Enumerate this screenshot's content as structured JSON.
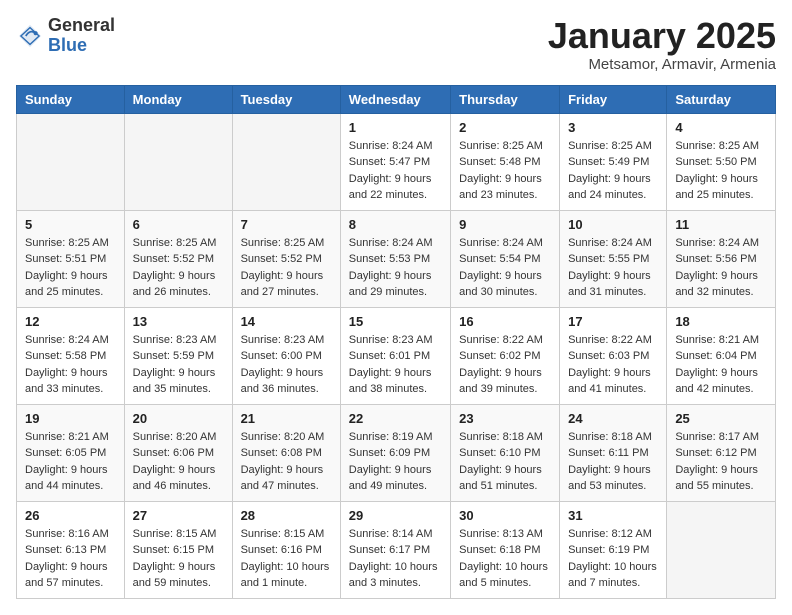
{
  "header": {
    "logo_general": "General",
    "logo_blue": "Blue",
    "title": "January 2025",
    "subtitle": "Metsamor, Armavir, Armenia"
  },
  "weekdays": [
    "Sunday",
    "Monday",
    "Tuesday",
    "Wednesday",
    "Thursday",
    "Friday",
    "Saturday"
  ],
  "weeks": [
    [
      {
        "day": "",
        "sunrise": "",
        "sunset": "",
        "daylight": ""
      },
      {
        "day": "",
        "sunrise": "",
        "sunset": "",
        "daylight": ""
      },
      {
        "day": "",
        "sunrise": "",
        "sunset": "",
        "daylight": ""
      },
      {
        "day": "1",
        "sunrise": "Sunrise: 8:24 AM",
        "sunset": "Sunset: 5:47 PM",
        "daylight": "Daylight: 9 hours and 22 minutes."
      },
      {
        "day": "2",
        "sunrise": "Sunrise: 8:25 AM",
        "sunset": "Sunset: 5:48 PM",
        "daylight": "Daylight: 9 hours and 23 minutes."
      },
      {
        "day": "3",
        "sunrise": "Sunrise: 8:25 AM",
        "sunset": "Sunset: 5:49 PM",
        "daylight": "Daylight: 9 hours and 24 minutes."
      },
      {
        "day": "4",
        "sunrise": "Sunrise: 8:25 AM",
        "sunset": "Sunset: 5:50 PM",
        "daylight": "Daylight: 9 hours and 25 minutes."
      }
    ],
    [
      {
        "day": "5",
        "sunrise": "Sunrise: 8:25 AM",
        "sunset": "Sunset: 5:51 PM",
        "daylight": "Daylight: 9 hours and 25 minutes."
      },
      {
        "day": "6",
        "sunrise": "Sunrise: 8:25 AM",
        "sunset": "Sunset: 5:52 PM",
        "daylight": "Daylight: 9 hours and 26 minutes."
      },
      {
        "day": "7",
        "sunrise": "Sunrise: 8:25 AM",
        "sunset": "Sunset: 5:52 PM",
        "daylight": "Daylight: 9 hours and 27 minutes."
      },
      {
        "day": "8",
        "sunrise": "Sunrise: 8:24 AM",
        "sunset": "Sunset: 5:53 PM",
        "daylight": "Daylight: 9 hours and 29 minutes."
      },
      {
        "day": "9",
        "sunrise": "Sunrise: 8:24 AM",
        "sunset": "Sunset: 5:54 PM",
        "daylight": "Daylight: 9 hours and 30 minutes."
      },
      {
        "day": "10",
        "sunrise": "Sunrise: 8:24 AM",
        "sunset": "Sunset: 5:55 PM",
        "daylight": "Daylight: 9 hours and 31 minutes."
      },
      {
        "day": "11",
        "sunrise": "Sunrise: 8:24 AM",
        "sunset": "Sunset: 5:56 PM",
        "daylight": "Daylight: 9 hours and 32 minutes."
      }
    ],
    [
      {
        "day": "12",
        "sunrise": "Sunrise: 8:24 AM",
        "sunset": "Sunset: 5:58 PM",
        "daylight": "Daylight: 9 hours and 33 minutes."
      },
      {
        "day": "13",
        "sunrise": "Sunrise: 8:23 AM",
        "sunset": "Sunset: 5:59 PM",
        "daylight": "Daylight: 9 hours and 35 minutes."
      },
      {
        "day": "14",
        "sunrise": "Sunrise: 8:23 AM",
        "sunset": "Sunset: 6:00 PM",
        "daylight": "Daylight: 9 hours and 36 minutes."
      },
      {
        "day": "15",
        "sunrise": "Sunrise: 8:23 AM",
        "sunset": "Sunset: 6:01 PM",
        "daylight": "Daylight: 9 hours and 38 minutes."
      },
      {
        "day": "16",
        "sunrise": "Sunrise: 8:22 AM",
        "sunset": "Sunset: 6:02 PM",
        "daylight": "Daylight: 9 hours and 39 minutes."
      },
      {
        "day": "17",
        "sunrise": "Sunrise: 8:22 AM",
        "sunset": "Sunset: 6:03 PM",
        "daylight": "Daylight: 9 hours and 41 minutes."
      },
      {
        "day": "18",
        "sunrise": "Sunrise: 8:21 AM",
        "sunset": "Sunset: 6:04 PM",
        "daylight": "Daylight: 9 hours and 42 minutes."
      }
    ],
    [
      {
        "day": "19",
        "sunrise": "Sunrise: 8:21 AM",
        "sunset": "Sunset: 6:05 PM",
        "daylight": "Daylight: 9 hours and 44 minutes."
      },
      {
        "day": "20",
        "sunrise": "Sunrise: 8:20 AM",
        "sunset": "Sunset: 6:06 PM",
        "daylight": "Daylight: 9 hours and 46 minutes."
      },
      {
        "day": "21",
        "sunrise": "Sunrise: 8:20 AM",
        "sunset": "Sunset: 6:08 PM",
        "daylight": "Daylight: 9 hours and 47 minutes."
      },
      {
        "day": "22",
        "sunrise": "Sunrise: 8:19 AM",
        "sunset": "Sunset: 6:09 PM",
        "daylight": "Daylight: 9 hours and 49 minutes."
      },
      {
        "day": "23",
        "sunrise": "Sunrise: 8:18 AM",
        "sunset": "Sunset: 6:10 PM",
        "daylight": "Daylight: 9 hours and 51 minutes."
      },
      {
        "day": "24",
        "sunrise": "Sunrise: 8:18 AM",
        "sunset": "Sunset: 6:11 PM",
        "daylight": "Daylight: 9 hours and 53 minutes."
      },
      {
        "day": "25",
        "sunrise": "Sunrise: 8:17 AM",
        "sunset": "Sunset: 6:12 PM",
        "daylight": "Daylight: 9 hours and 55 minutes."
      }
    ],
    [
      {
        "day": "26",
        "sunrise": "Sunrise: 8:16 AM",
        "sunset": "Sunset: 6:13 PM",
        "daylight": "Daylight: 9 hours and 57 minutes."
      },
      {
        "day": "27",
        "sunrise": "Sunrise: 8:15 AM",
        "sunset": "Sunset: 6:15 PM",
        "daylight": "Daylight: 9 hours and 59 minutes."
      },
      {
        "day": "28",
        "sunrise": "Sunrise: 8:15 AM",
        "sunset": "Sunset: 6:16 PM",
        "daylight": "Daylight: 10 hours and 1 minute."
      },
      {
        "day": "29",
        "sunrise": "Sunrise: 8:14 AM",
        "sunset": "Sunset: 6:17 PM",
        "daylight": "Daylight: 10 hours and 3 minutes."
      },
      {
        "day": "30",
        "sunrise": "Sunrise: 8:13 AM",
        "sunset": "Sunset: 6:18 PM",
        "daylight": "Daylight: 10 hours and 5 minutes."
      },
      {
        "day": "31",
        "sunrise": "Sunrise: 8:12 AM",
        "sunset": "Sunset: 6:19 PM",
        "daylight": "Daylight: 10 hours and 7 minutes."
      },
      {
        "day": "",
        "sunrise": "",
        "sunset": "",
        "daylight": ""
      }
    ]
  ]
}
